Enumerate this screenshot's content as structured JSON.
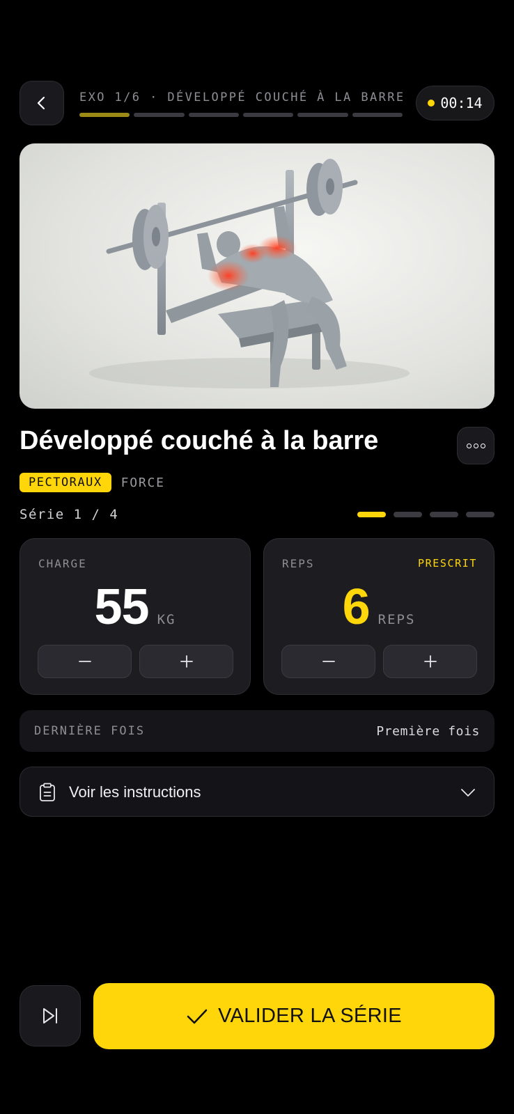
{
  "header": {
    "exercise_progress": "EXO 1/6 · DÉVELOPPÉ COUCHÉ À LA BARRE",
    "current_exercise": 1,
    "total_exercises": 6,
    "timer": "00:14"
  },
  "exercise": {
    "title": "Développé couché à la barre",
    "tags": [
      "PECTORAUX",
      "FORCE"
    ]
  },
  "serie": {
    "label": "Série 1 / 4",
    "current": 1,
    "total": 4
  },
  "charge": {
    "label": "CHARGE",
    "value": "55",
    "unit": "KG"
  },
  "reps": {
    "label": "REPS",
    "badge": "PRESCRIT",
    "value": "6",
    "unit": "REPS"
  },
  "last_time": {
    "label": "DERNIÈRE FOIS",
    "value": "Première fois"
  },
  "instructions": {
    "label": "Voir les instructions"
  },
  "actions": {
    "validate_label": "VALIDER LA SÉRIE"
  },
  "icons": {
    "back": "chevron-left-icon",
    "more": "more-horizontal-icon",
    "minus": "minus-icon",
    "plus": "plus-icon",
    "clipboard": "clipboard-icon",
    "chevron_down": "chevron-down-icon",
    "skip": "skip-forward-icon",
    "check": "check-icon"
  },
  "colors": {
    "accent": "#ffd60a",
    "background": "#000000",
    "card": "#1c1c21",
    "muted": "#8e8e95"
  }
}
